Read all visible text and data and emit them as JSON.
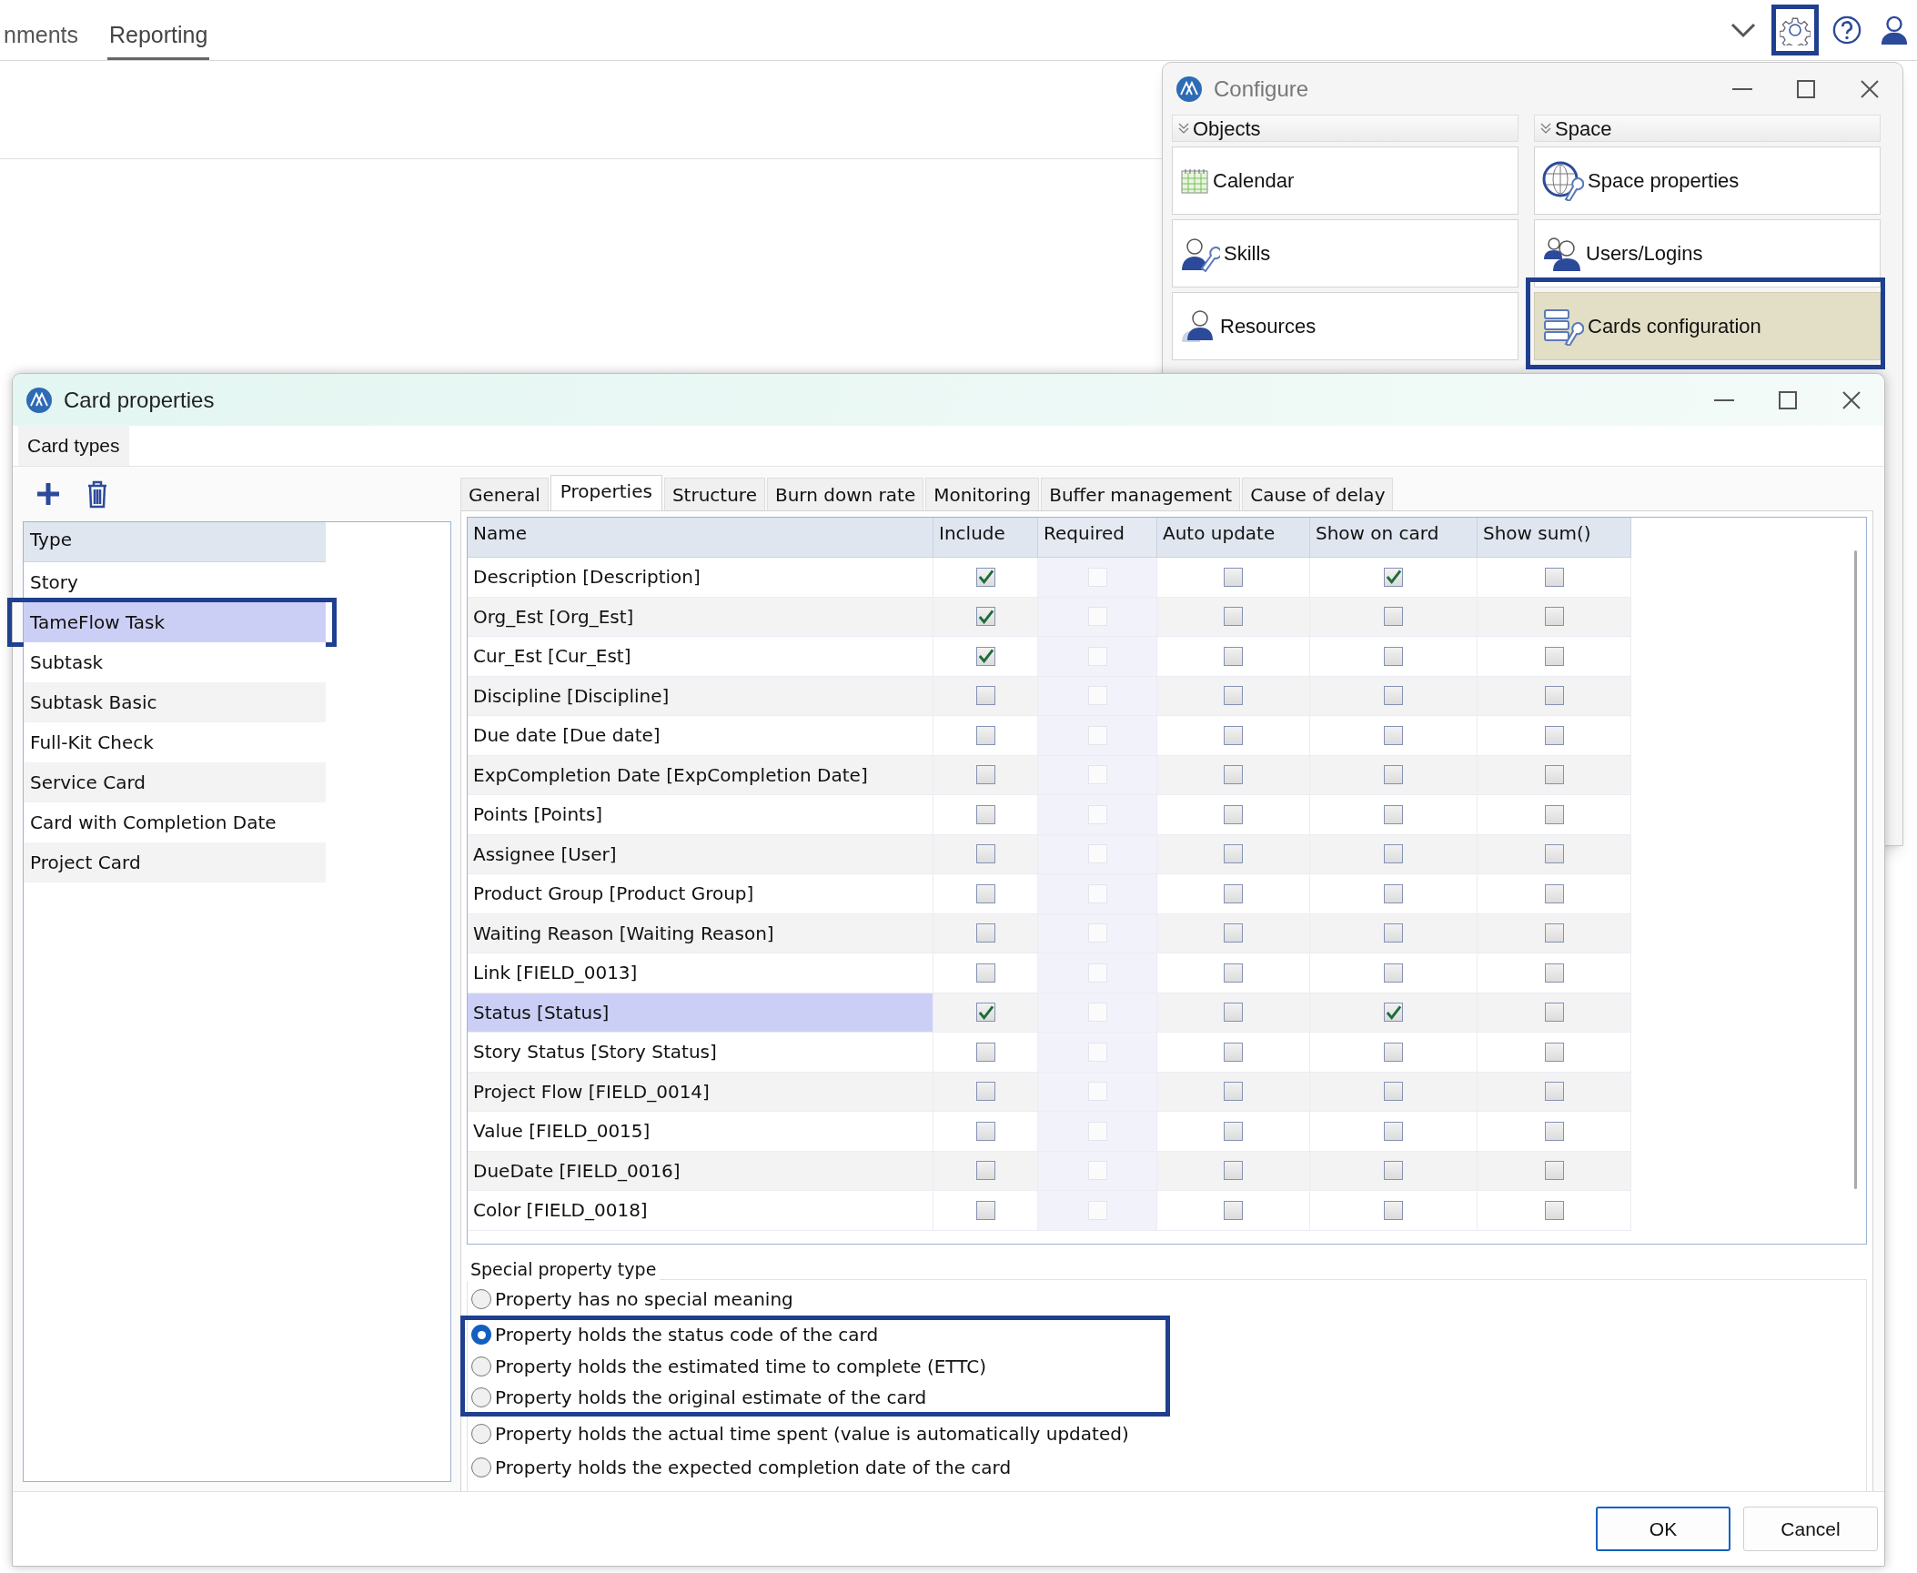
{
  "app_tabs": [
    {
      "label": "nments",
      "selected": false
    },
    {
      "label": "Reporting",
      "selected": true
    }
  ],
  "toolbar_icons": [
    {
      "kind": "chevron",
      "highlight": false
    },
    {
      "kind": "gear",
      "highlight": true
    },
    {
      "kind": "help",
      "highlight": false
    },
    {
      "kind": "user",
      "highlight": false
    }
  ],
  "configure_window": {
    "title": "Configure",
    "groups": [
      {
        "title": "Objects",
        "items": [
          {
            "label": "Calendar",
            "kind": "calendar",
            "selected": false
          },
          {
            "label": "Skills",
            "kind": "skills",
            "selected": false
          },
          {
            "label": "Resources",
            "kind": "resources",
            "selected": false
          }
        ]
      },
      {
        "title": "Space",
        "items": [
          {
            "label": "Space properties",
            "kind": "globe",
            "selected": false
          },
          {
            "label": "Users/Logins",
            "kind": "users",
            "selected": false
          },
          {
            "label": "Cards configuration",
            "kind": "cards",
            "selected": true
          }
        ]
      }
    ]
  },
  "card_properties_window": {
    "title": "Card properties",
    "side_tab": "Card types",
    "card_types": {
      "column": "Type",
      "items": [
        {
          "label": "Story",
          "selected": false
        },
        {
          "label": "TameFlow Task",
          "selected": true
        },
        {
          "label": "Subtask",
          "selected": false
        },
        {
          "label": "Subtask Basic",
          "selected": false
        },
        {
          "label": "Full-Kit Check",
          "selected": false
        },
        {
          "label": "Service Card",
          "selected": false
        },
        {
          "label": "Card with Completion Date",
          "selected": false
        },
        {
          "label": "Project Card",
          "selected": false
        }
      ]
    },
    "tabs": [
      {
        "label": "General",
        "selected": false
      },
      {
        "label": "Properties",
        "selected": true
      },
      {
        "label": "Structure",
        "selected": false
      },
      {
        "label": "Burn down rate",
        "selected": false
      },
      {
        "label": "Monitoring",
        "selected": false
      },
      {
        "label": "Buffer management",
        "selected": false
      },
      {
        "label": "Cause of delay",
        "selected": false
      }
    ],
    "table": {
      "columns": [
        {
          "label": "Name"
        },
        {
          "label": "Include",
          "disabled": false
        },
        {
          "label": "Required",
          "disabled": true
        },
        {
          "label": "Auto update",
          "disabled": false
        },
        {
          "label": "Show on card",
          "disabled": false
        },
        {
          "label": "Show sum()",
          "disabled": false
        }
      ],
      "rows": [
        {
          "name": "Description [Description]",
          "selected": false,
          "checks": [
            true,
            false,
            false,
            true,
            false
          ]
        },
        {
          "name": "Org_Est [Org_Est]",
          "selected": false,
          "checks": [
            true,
            false,
            false,
            false,
            false
          ]
        },
        {
          "name": "Cur_Est [Cur_Est]",
          "selected": false,
          "checks": [
            true,
            false,
            false,
            false,
            false
          ]
        },
        {
          "name": "Discipline [Discipline]",
          "selected": false,
          "checks": [
            false,
            false,
            false,
            false,
            false
          ]
        },
        {
          "name": "Due date [Due date]",
          "selected": false,
          "checks": [
            false,
            false,
            false,
            false,
            false
          ]
        },
        {
          "name": "ExpCompletion Date [ExpCompletion Date]",
          "selected": false,
          "checks": [
            false,
            false,
            false,
            false,
            false
          ]
        },
        {
          "name": "Points [Points]",
          "selected": false,
          "checks": [
            false,
            false,
            false,
            false,
            false
          ]
        },
        {
          "name": "Assignee [User]",
          "selected": false,
          "checks": [
            false,
            false,
            false,
            false,
            false
          ]
        },
        {
          "name": "Product Group [Product Group]",
          "selected": false,
          "checks": [
            false,
            false,
            false,
            false,
            false
          ]
        },
        {
          "name": "Waiting Reason [Waiting Reason]",
          "selected": false,
          "checks": [
            false,
            false,
            false,
            false,
            false
          ]
        },
        {
          "name": "Link [FIELD_0013]",
          "selected": false,
          "checks": [
            false,
            false,
            false,
            false,
            false
          ]
        },
        {
          "name": "Status [Status]",
          "selected": true,
          "checks": [
            true,
            false,
            false,
            true,
            false
          ]
        },
        {
          "name": "Story Status [Story Status]",
          "selected": false,
          "checks": [
            false,
            false,
            false,
            false,
            false
          ]
        },
        {
          "name": "Project Flow [FIELD_0014]",
          "selected": false,
          "checks": [
            false,
            false,
            false,
            false,
            false
          ]
        },
        {
          "name": "Value [FIELD_0015]",
          "selected": false,
          "checks": [
            false,
            false,
            false,
            false,
            false
          ]
        },
        {
          "name": "DueDate [FIELD_0016]",
          "selected": false,
          "checks": [
            false,
            false,
            false,
            false,
            false
          ]
        },
        {
          "name": "Color [FIELD_0018]",
          "selected": false,
          "checks": [
            false,
            false,
            false,
            false,
            false
          ]
        }
      ]
    },
    "special_property_type": {
      "title": "Special property type",
      "options": [
        {
          "label": "Property has no special meaning",
          "selected": false,
          "highlight": false
        },
        {
          "label": "Property holds the status code of the card",
          "selected": true,
          "highlight": true
        },
        {
          "label": "Property holds the estimated time to complete (ETTC)",
          "selected": false,
          "highlight": true
        },
        {
          "label": "Property holds the original estimate of the card",
          "selected": false,
          "highlight": true
        },
        {
          "label": "Property holds the actual time spent (value is automatically updated)",
          "selected": false,
          "highlight": false
        },
        {
          "label": "Property holds the expected completion date of the card",
          "selected": false,
          "highlight": false
        }
      ]
    },
    "buttons": [
      "OK",
      "Cancel"
    ]
  }
}
